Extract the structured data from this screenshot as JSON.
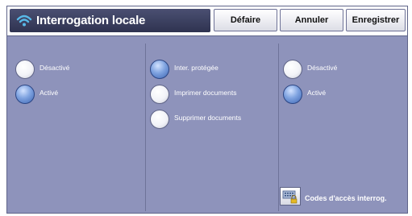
{
  "header": {
    "title": "Interrogation locale",
    "buttons": {
      "defaire": "Défaire",
      "annuler": "Annuler",
      "enregistrer": "Enregistrer"
    }
  },
  "group1": {
    "options": [
      {
        "label": "Désactivé",
        "selected": false
      },
      {
        "label": "Activé",
        "selected": true
      }
    ]
  },
  "group2": {
    "options": [
      {
        "label": "Inter. protégée",
        "selected": true
      },
      {
        "label": "Imprimer documents",
        "selected": false
      },
      {
        "label": "Supprimer documents",
        "selected": false
      }
    ]
  },
  "group3": {
    "options": [
      {
        "label": "Désactivé",
        "selected": false
      },
      {
        "label": "Activé",
        "selected": true
      }
    ]
  },
  "codes": {
    "label": "Codes d'accès interrog.",
    "icon": "keypad-lock-icon"
  },
  "colors": {
    "panel": "#8e93bb",
    "title_bar": "#3a3e5e",
    "radio_selected": "#5b7fc6"
  }
}
